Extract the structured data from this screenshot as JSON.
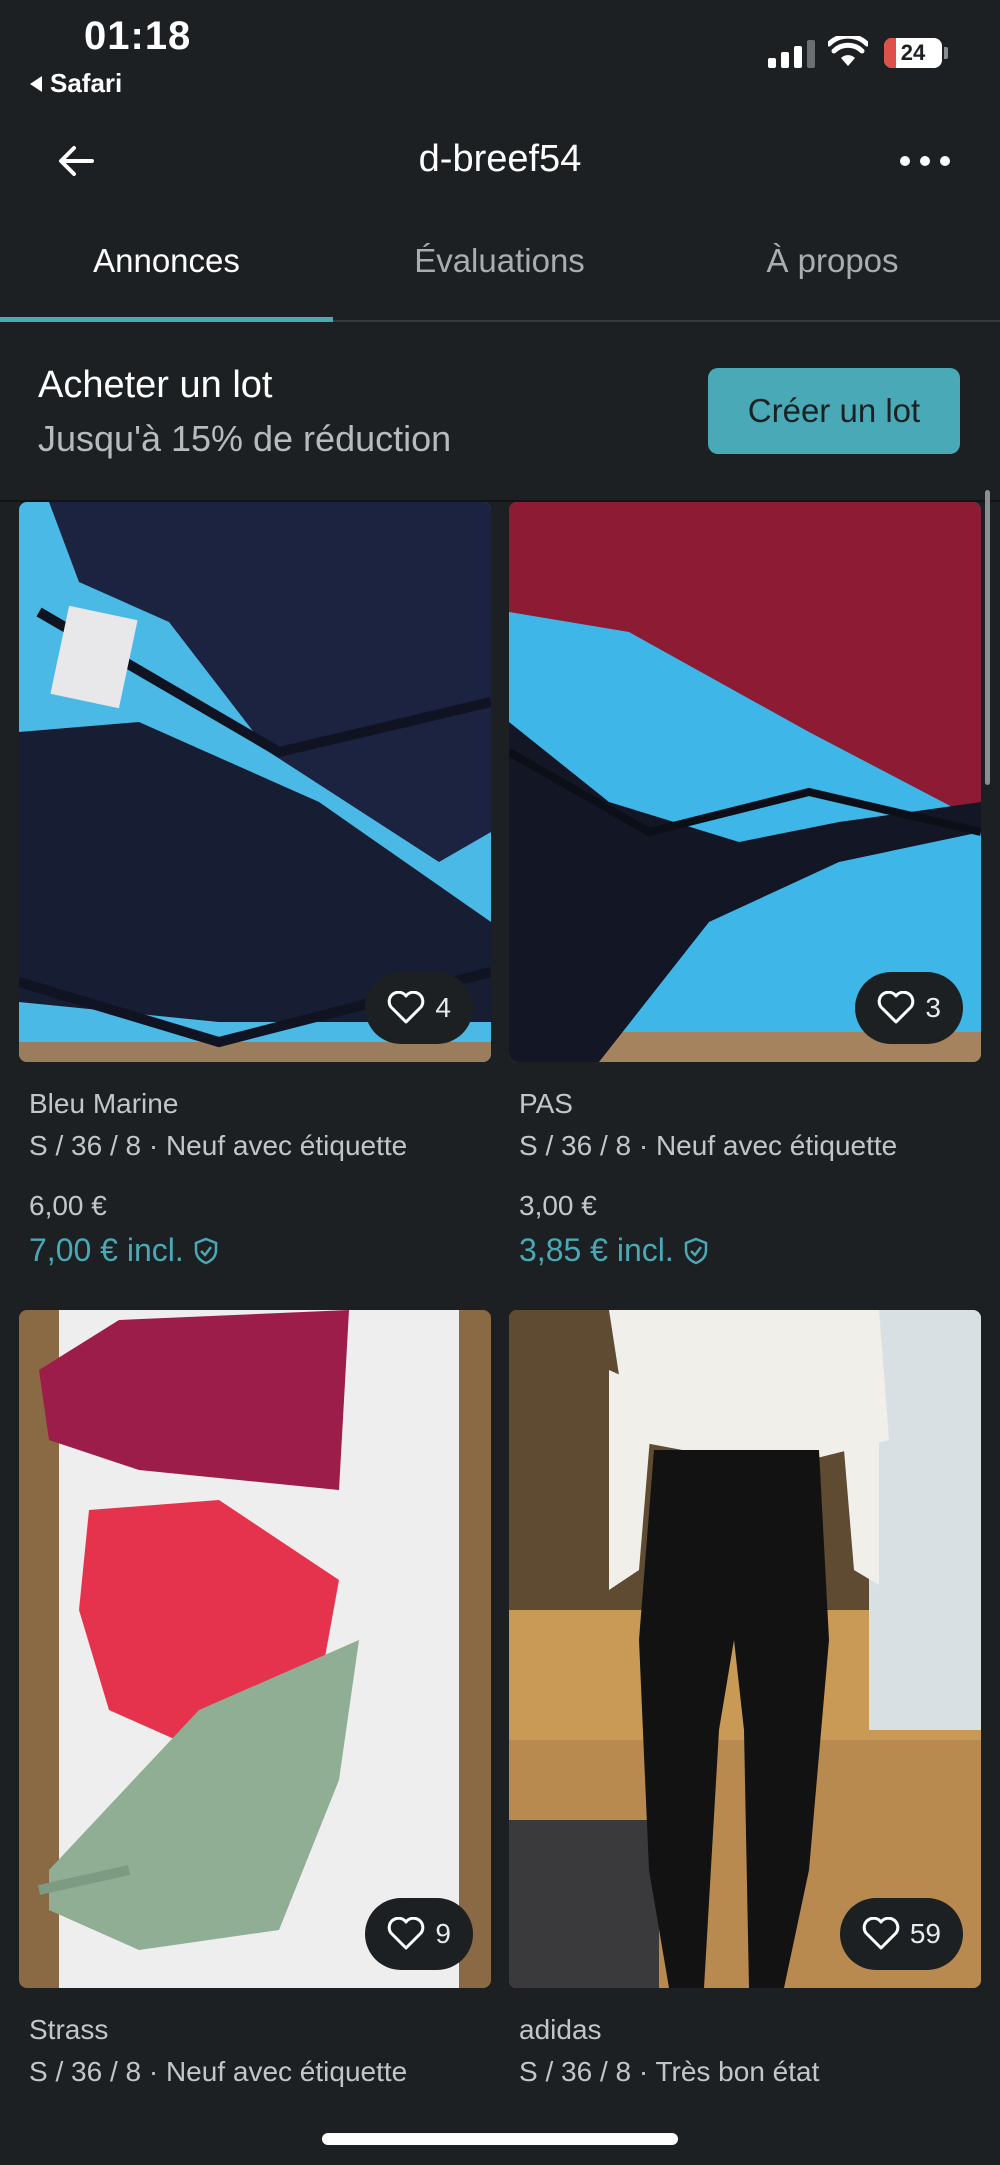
{
  "status": {
    "time": "01:18",
    "back_app": "Safari",
    "battery": "24",
    "icons": [
      "cellular-icon",
      "wifi-icon",
      "battery-icon"
    ]
  },
  "nav": {
    "title": "d-breef54",
    "back_icon": "arrow-left-icon",
    "more_icon": "more-horizontal-icon"
  },
  "tabs": [
    {
      "label": "Annonces"
    },
    {
      "label": "Évaluations"
    },
    {
      "label": "À propos"
    }
  ],
  "bundle": {
    "title": "Acheter un lot",
    "subtitle": "Jusqu'à 15% de réduction",
    "button": "Créer un lot"
  },
  "items": [
    {
      "title": "Bleu Marine",
      "meta": "S / 36 / 8 · Neuf avec étiquette",
      "price": "6,00 €",
      "price_incl": "7,00 € incl.",
      "favorites": "4"
    },
    {
      "title": "PAS",
      "meta": "S / 36 / 8 · Neuf avec étiquette",
      "price": "3,00 €",
      "price_incl": "3,85 € incl.",
      "favorites": "3"
    },
    {
      "title": "Strass",
      "meta": "S / 36 / 8 · Neuf avec étiquette",
      "favorites": "9"
    },
    {
      "title": "adidas",
      "meta": "S / 36 / 8 · Très bon état",
      "favorites": "59"
    }
  ],
  "colors": {
    "background": "#1c2022",
    "accent": "#4aa9b6",
    "text_muted": "#c3c6c8"
  }
}
